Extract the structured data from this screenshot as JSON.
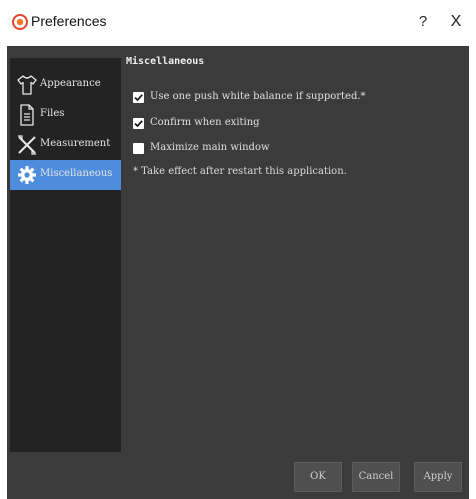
{
  "window": {
    "title": "Preferences",
    "help_label": "?",
    "close_label": "X"
  },
  "sidebar": {
    "items": [
      {
        "label": "Appearance",
        "icon": "shirt-icon",
        "selected": false
      },
      {
        "label": "Files",
        "icon": "document-icon",
        "selected": false
      },
      {
        "label": "Measurement",
        "icon": "measurement-icon",
        "selected": false
      },
      {
        "label": "Miscellaneous",
        "icon": "gear-icon",
        "selected": true
      }
    ]
  },
  "main": {
    "section_title": "Miscellaneous",
    "options": [
      {
        "label": "Use one push white balance if supported.*",
        "checked": true
      },
      {
        "label": "Confirm when exiting",
        "checked": true
      },
      {
        "label": "Maximize main window",
        "checked": false
      }
    ],
    "note": "* Take effect after restart this application."
  },
  "buttons": {
    "ok": "OK",
    "cancel": "Cancel",
    "apply": "Apply"
  },
  "colors": {
    "selected_item": "#4e8ddb",
    "dialog_bg": "#3b3b3b",
    "sidebar_bg": "#232323",
    "app_icon": "#e0452b"
  }
}
